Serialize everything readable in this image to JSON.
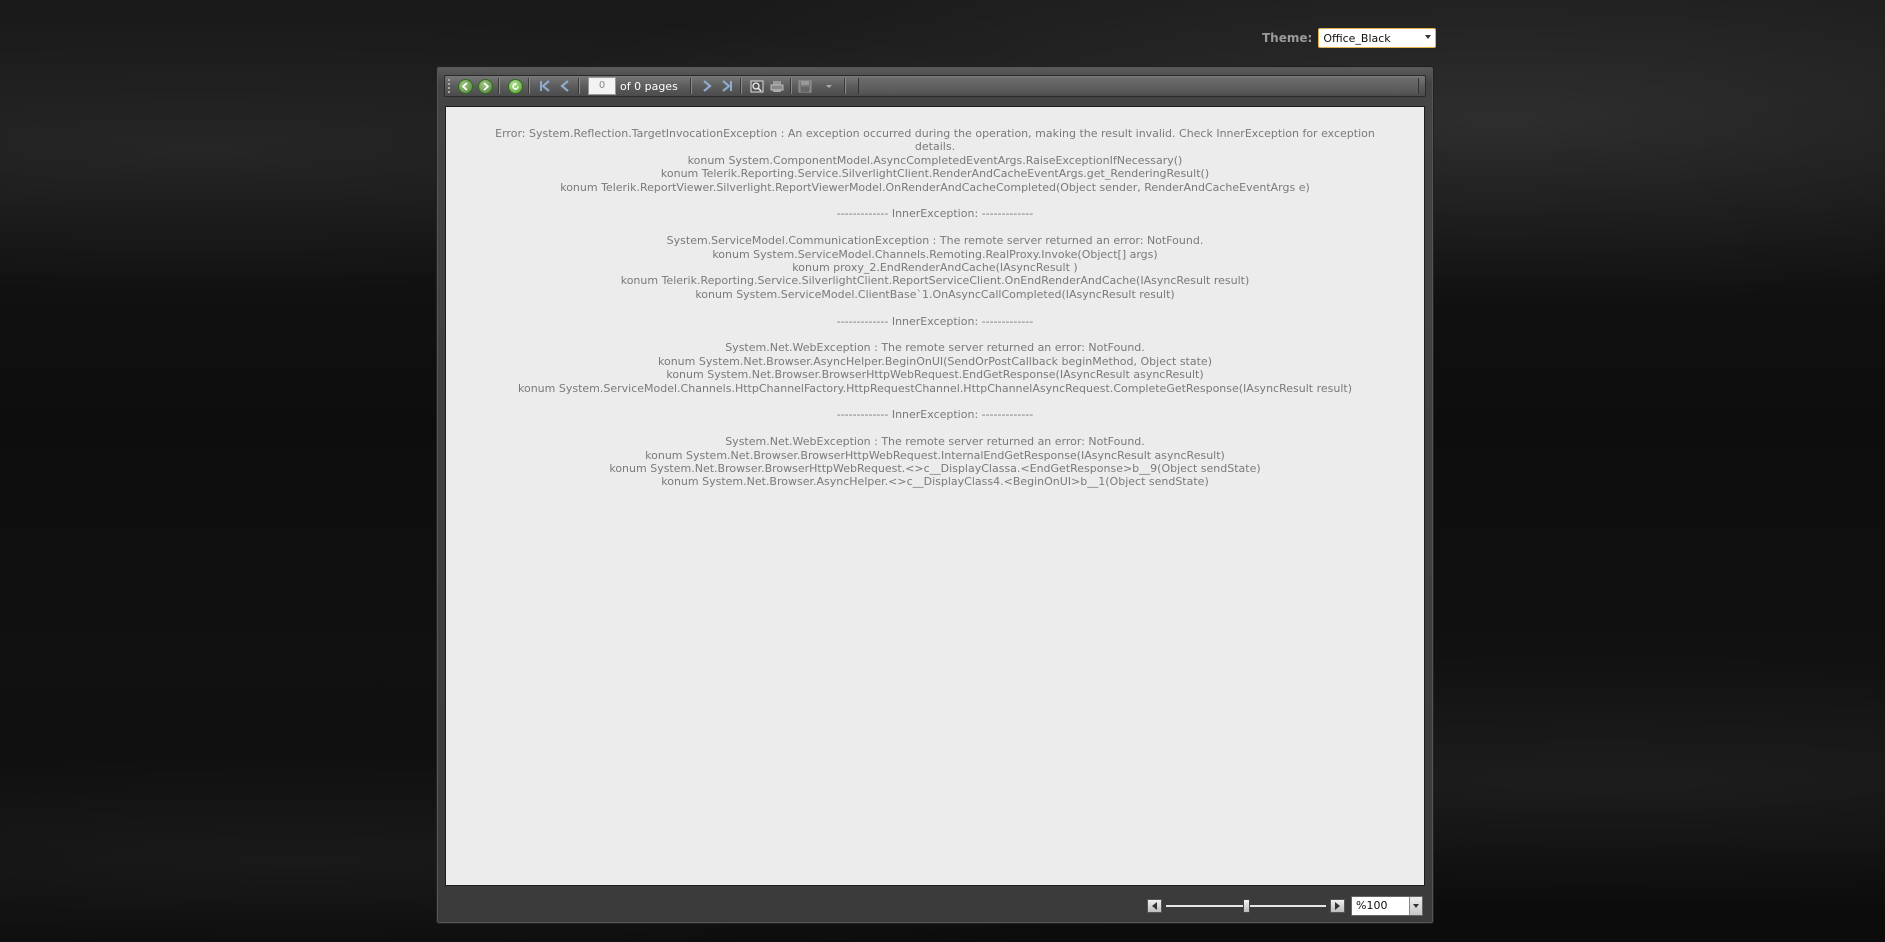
{
  "theme": {
    "label": "Theme:",
    "selected": "Office_Black"
  },
  "toolbar": {
    "page_current": "0",
    "page_total_text": "of 0 pages",
    "icons": [
      "back-icon",
      "forward-icon",
      "refresh-icon",
      "first-page-icon",
      "previous-page-icon",
      "next-page-icon",
      "last-page-icon",
      "print-preview-icon",
      "print-icon",
      "export-icon"
    ]
  },
  "report": {
    "lines": [
      {
        "text": "Error: System.Reflection.TargetInvocationException : An exception occurred during the operation, making the result invalid.  Check InnerException for exception details.",
        "wrap": true
      },
      {
        "text": "konum System.ComponentModel.AsyncCompletedEventArgs.RaiseExceptionIfNecessary()"
      },
      {
        "text": "konum Telerik.Reporting.Service.SilverlightClient.RenderAndCacheEventArgs.get_RenderingResult()"
      },
      {
        "text": "konum Telerik.ReportViewer.Silverlight.ReportViewerModel.OnRenderAndCacheCompleted(Object sender, RenderAndCacheEventArgs e)"
      },
      {
        "gap": true
      },
      {
        "text": "------------- InnerException: -------------"
      },
      {
        "gap": true
      },
      {
        "text": "System.ServiceModel.CommunicationException : The remote server returned an error: NotFound."
      },
      {
        "text": "konum System.ServiceModel.Channels.Remoting.RealProxy.Invoke(Object[] args)"
      },
      {
        "text": "konum proxy_2.EndRenderAndCache(IAsyncResult )"
      },
      {
        "text": "konum Telerik.Reporting.Service.SilverlightClient.ReportServiceClient.OnEndRenderAndCache(IAsyncResult result)"
      },
      {
        "text": "konum System.ServiceModel.ClientBase`1.OnAsyncCallCompleted(IAsyncResult result)"
      },
      {
        "gap": true
      },
      {
        "text": "------------- InnerException: -------------"
      },
      {
        "gap": true
      },
      {
        "text": "System.Net.WebException : The remote server returned an error: NotFound."
      },
      {
        "text": "konum System.Net.Browser.AsyncHelper.BeginOnUI(SendOrPostCallback beginMethod, Object state)"
      },
      {
        "text": "konum System.Net.Browser.BrowserHttpWebRequest.EndGetResponse(IAsyncResult asyncResult)"
      },
      {
        "text": "konum System.ServiceModel.Channels.HttpChannelFactory.HttpRequestChannel.HttpChannelAsyncRequest.CompleteGetResponse(IAsyncResult result)"
      },
      {
        "gap": true
      },
      {
        "text": "------------- InnerException: -------------"
      },
      {
        "gap": true
      },
      {
        "text": "System.Net.WebException : The remote server returned an error: NotFound."
      },
      {
        "text": "konum System.Net.Browser.BrowserHttpWebRequest.InternalEndGetResponse(IAsyncResult asyncResult)"
      },
      {
        "text": "konum System.Net.Browser.BrowserHttpWebRequest.<>c__DisplayClassa.<EndGetResponse>b__9(Object sendState)"
      },
      {
        "text": "konum System.Net.Browser.AsyncHelper.<>c__DisplayClass4.<BeginOnUI>b__1(Object sendState)"
      }
    ]
  },
  "zoom": {
    "value": "%100",
    "level_fraction": 0.5
  }
}
